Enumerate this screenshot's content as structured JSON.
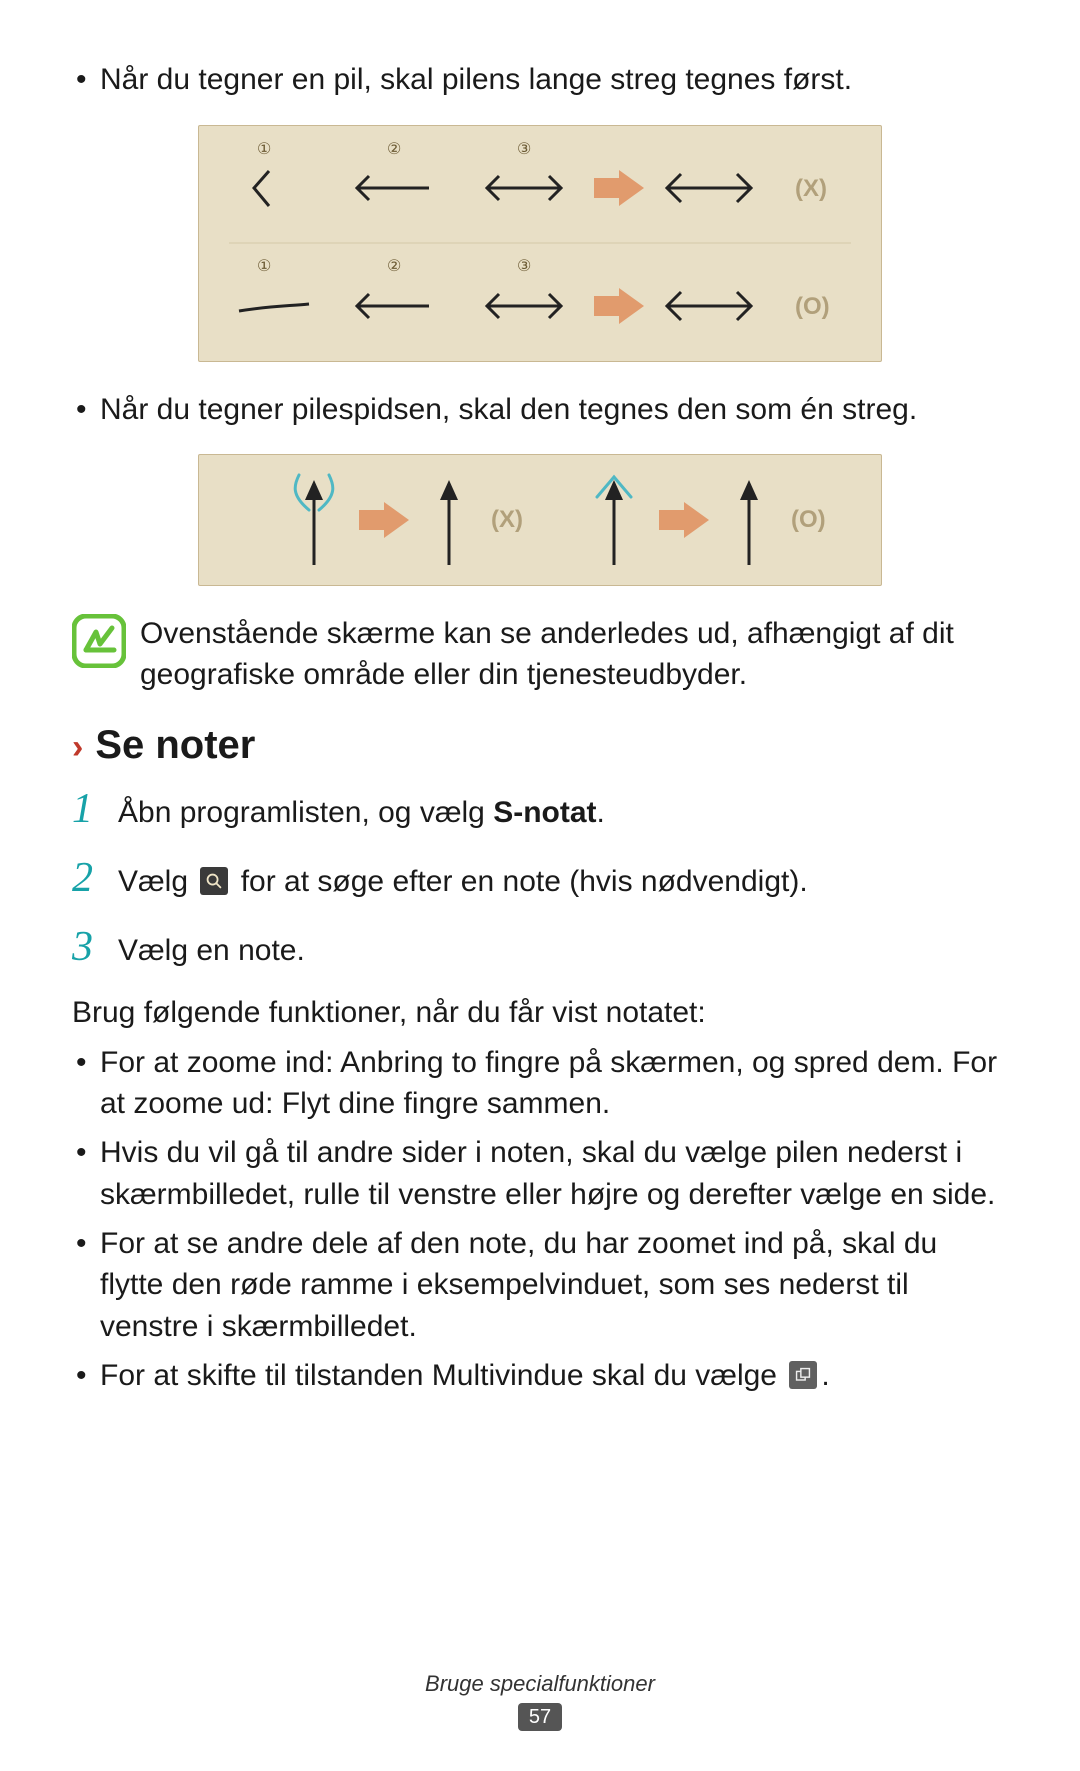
{
  "bullets_top": {
    "b1": "Når du tegner en pil, skal pilens lange streg tegnes først.",
    "b2": "Når du tegner pilespidsen, skal den tegnes den som én streg."
  },
  "illustration1": {
    "row1_steps": [
      "①",
      "②",
      "③"
    ],
    "row1_mark": "(X)",
    "row2_steps": [
      "①",
      "②",
      "③"
    ],
    "row2_mark": "(O)"
  },
  "illustration2": {
    "left_mark": "(X)",
    "right_mark": "(O)"
  },
  "note": "Ovenstående skærme kan se anderledes ud, afhængigt af dit geografiske område eller din tjenesteudbyder.",
  "section": {
    "chevron": "›",
    "title": "Se noter"
  },
  "steps": [
    {
      "num": "1",
      "pre": "Åbn programlisten, og vælg ",
      "bold": "S-notat",
      "post": "."
    },
    {
      "num": "2",
      "pre": "Vælg ",
      "post": " for at søge efter en note (hvis nødvendigt).",
      "icon": "search"
    },
    {
      "num": "3",
      "pre": "Vælg en note."
    }
  ],
  "after_steps_intro": "Brug følgende funktioner, når du får vist notatet:",
  "func_list": [
    "For at zoome ind: Anbring to fingre på skærmen, og spred dem. For at zoome ud: Flyt dine fingre sammen.",
    "Hvis du vil gå til andre sider i noten, skal du vælge pilen nederst i skærmbilledet, rulle til venstre eller højre og derefter vælge en side.",
    "For at se andre dele af den note, du har zoomet ind på, skal du flytte den røde ramme i eksempelvinduet, som ses nederst til venstre i skærmbilledet."
  ],
  "func_last": {
    "pre": "For at skifte til tilstanden Multivindue skal du vælge ",
    "post": "."
  },
  "footer": {
    "text": "Bruge specialfunktioner",
    "page": "57"
  }
}
